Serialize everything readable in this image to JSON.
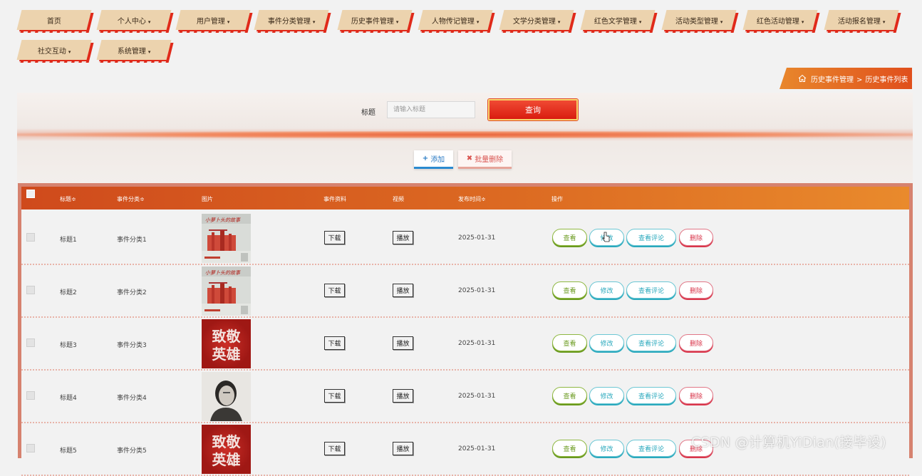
{
  "nav": {
    "items": [
      {
        "label": "首页",
        "dropdown": false
      },
      {
        "label": "个人中心",
        "dropdown": true
      },
      {
        "label": "用户管理",
        "dropdown": true
      },
      {
        "label": "事件分类管理",
        "dropdown": true
      },
      {
        "label": "历史事件管理",
        "dropdown": true
      },
      {
        "label": "人物传记管理",
        "dropdown": true
      },
      {
        "label": "文学分类管理",
        "dropdown": true
      },
      {
        "label": "红色文学管理",
        "dropdown": true
      },
      {
        "label": "活动类型管理",
        "dropdown": true
      },
      {
        "label": "红色活动管理",
        "dropdown": true
      },
      {
        "label": "活动报名管理",
        "dropdown": true
      },
      {
        "label": "社交互动",
        "dropdown": true
      },
      {
        "label": "系统管理",
        "dropdown": true
      }
    ],
    "caret": "▾"
  },
  "breadcrumb": {
    "parent": "历史事件管理",
    "separator": ">",
    "current": "历史事件列表"
  },
  "search": {
    "label": "标题",
    "placeholder": "请输入标题",
    "value": "",
    "button": "查询"
  },
  "toolbar": {
    "add_label": "添加",
    "add_icon": "+",
    "batch_delete_label": "批量删除",
    "batch_delete_icon": "✖"
  },
  "table": {
    "headers": {
      "title": "标题",
      "category": "事件分类",
      "image": "图片",
      "material": "事件资料",
      "video": "视频",
      "publish_time": "发布时间",
      "actions": "操作"
    },
    "sort_mark": "≑",
    "rows": [
      {
        "title": "标题1",
        "category": "事件分类1",
        "image": "book-cover",
        "download": "下载",
        "play": "播放",
        "date": "2025-01-31"
      },
      {
        "title": "标题2",
        "category": "事件分类2",
        "image": "book-cover",
        "download": "下载",
        "play": "播放",
        "date": "2025-01-31"
      },
      {
        "title": "标题3",
        "category": "事件分类3",
        "image": "tribute-poster",
        "download": "下载",
        "play": "播放",
        "date": "2025-01-31"
      },
      {
        "title": "标题4",
        "category": "事件分类4",
        "image": "portrait-photo",
        "download": "下载",
        "play": "播放",
        "date": "2025-01-31"
      },
      {
        "title": "标题5",
        "category": "事件分类5",
        "image": "tribute-poster",
        "download": "下载",
        "play": "播放",
        "date": "2025-01-31"
      }
    ],
    "actions": {
      "view": "查看",
      "edit": "修改",
      "comments": "查看评论",
      "delete": "删除"
    },
    "poster_text_line1": "致敬",
    "poster_text_line2": "英雄"
  },
  "watermark": "CSDN @计算机YiDian(接毕设)",
  "colors": {
    "nav_bg": "#ecd3ae",
    "nav_shadow": "#e02a1a",
    "header_gradient_start": "#cf4a1c",
    "header_gradient_end": "#e98a2c",
    "query_button": "#e3261a",
    "view": "#6a9a1e",
    "edit": "#2aa9bd",
    "delete": "#d9364b"
  }
}
